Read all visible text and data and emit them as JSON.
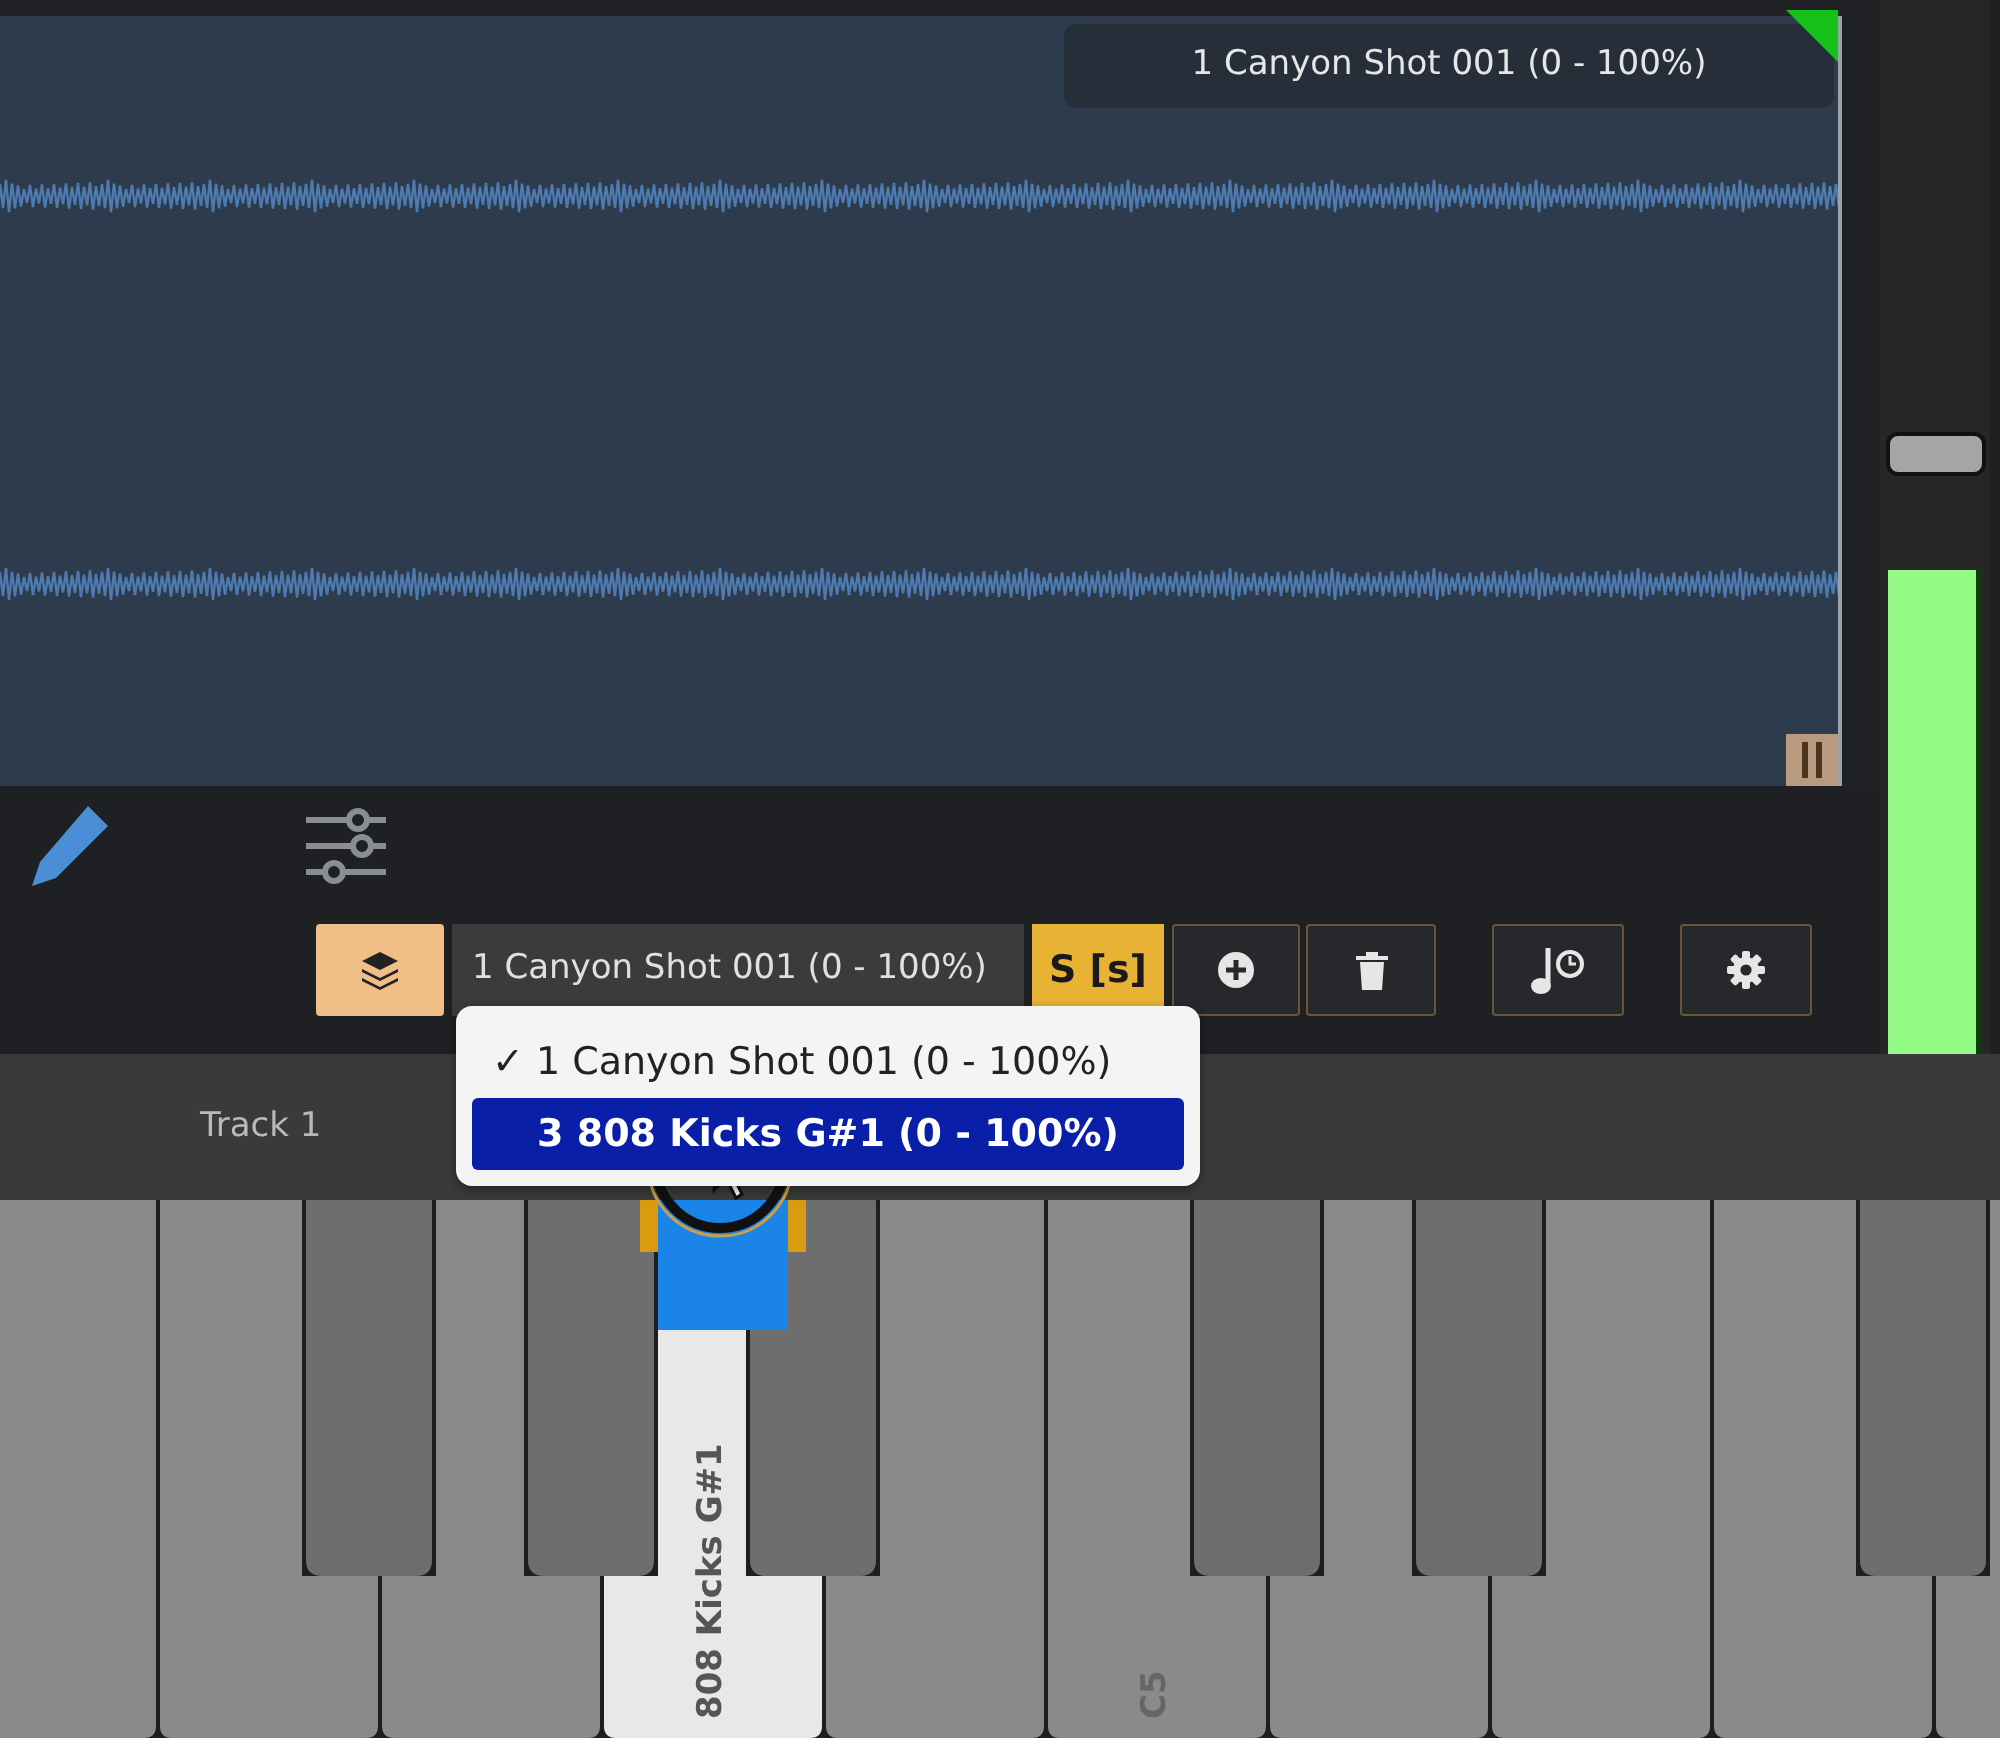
{
  "waveform": {
    "clip_label": "1 Canyon Shot 001 (0 - 100%)"
  },
  "fader": {
    "level": 0.57
  },
  "meter": {
    "level": 0.46
  },
  "toolbar": {
    "layer_select": {
      "value": "1 Canyon Shot 001 (0 - 100%)"
    },
    "solo_button": "S [s]"
  },
  "dropdown": {
    "check_glyph": "✓",
    "items": [
      {
        "label": "1 Canyon Shot 001 (0 - 100%)",
        "checked": true,
        "highlighted": false
      },
      {
        "label": "3 808 Kicks G#1 (0 - 100%)",
        "checked": false,
        "highlighted": true
      }
    ]
  },
  "track": {
    "label": "Track 1"
  },
  "keyboard": {
    "white_keys": [
      {
        "sharp": false,
        "selected": false
      },
      {
        "sharp": true,
        "selected": false
      },
      {
        "sharp": true,
        "selected": false
      },
      {
        "label": "808 Kicks G#1",
        "sharp": true,
        "selected": true
      },
      {
        "sharp": false,
        "selected": false
      },
      {
        "label": "C5",
        "sharp": true,
        "selected": false
      },
      {
        "sharp": true,
        "selected": false
      },
      {
        "sharp": false,
        "selected": false
      },
      {
        "sharp": true,
        "selected": false
      },
      {
        "sharp": false,
        "selected": false
      }
    ]
  }
}
